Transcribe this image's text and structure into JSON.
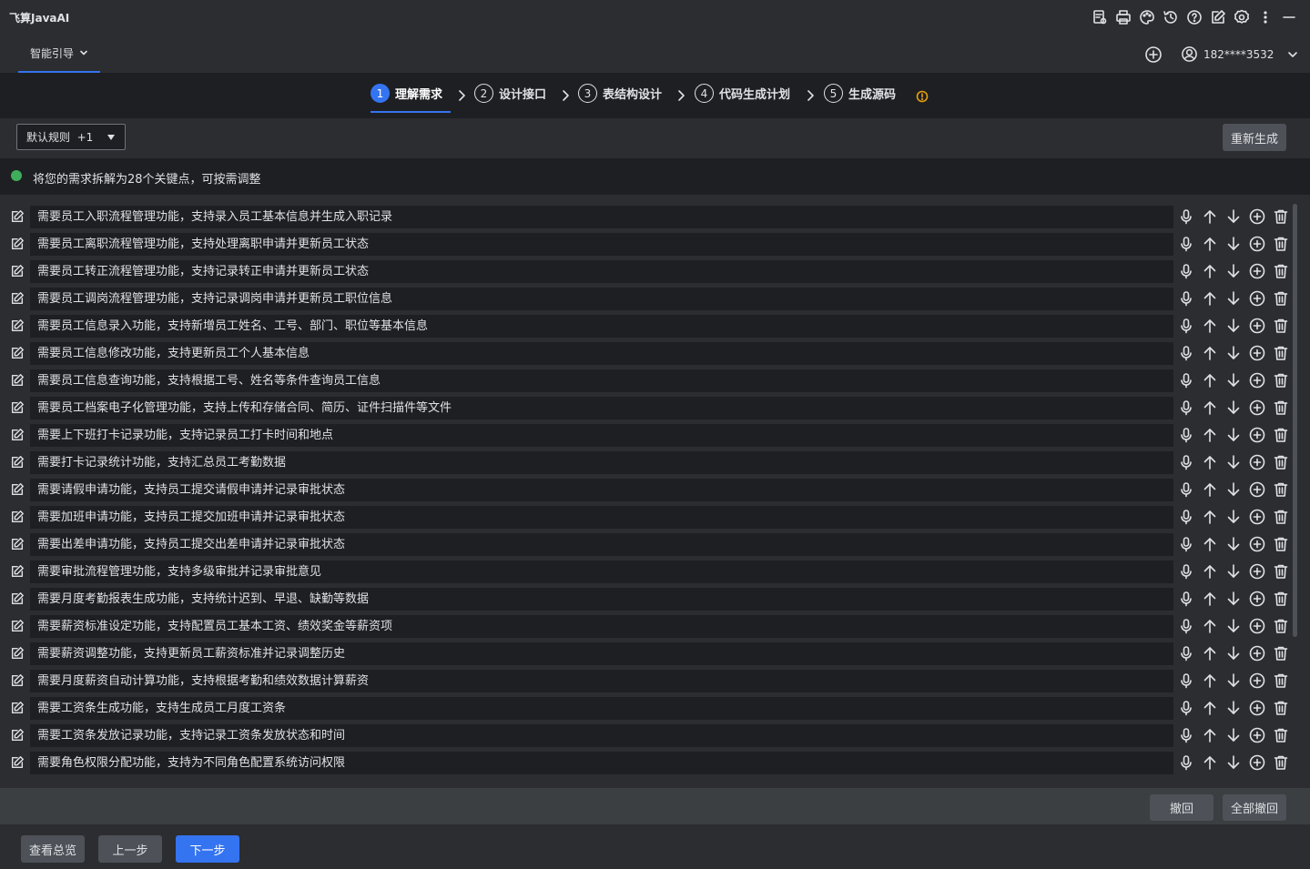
{
  "app": {
    "title": "飞算JavaAI"
  },
  "title_icons": [
    "document-settings-icon",
    "print-icon",
    "palette-icon",
    "history-icon",
    "help-icon",
    "edit-icon",
    "gear-icon",
    "more-vertical-icon",
    "minimize-icon"
  ],
  "nav": {
    "tab_label": "智能引导",
    "user_label": "182****3532"
  },
  "steps": [
    {
      "num": "1",
      "label": "理解需求",
      "active": true
    },
    {
      "num": "2",
      "label": "设计接口",
      "active": false
    },
    {
      "num": "3",
      "label": "表结构设计",
      "active": false
    },
    {
      "num": "4",
      "label": "代码生成计划",
      "active": false
    },
    {
      "num": "5",
      "label": "生成源码",
      "active": false
    }
  ],
  "rules": {
    "select_value": "默认规则  +1",
    "regenerate_label": "重新生成"
  },
  "summary": {
    "text": "将您的需求拆解为28个关键点，可按需调整"
  },
  "requirements": [
    "需要员工入职流程管理功能，支持录入员工基本信息并生成入职记录",
    "需要员工离职流程管理功能，支持处理离职申请并更新员工状态",
    "需要员工转正流程管理功能，支持记录转正申请并更新员工状态",
    "需要员工调岗流程管理功能，支持记录调岗申请并更新员工职位信息",
    "需要员工信息录入功能，支持新增员工姓名、工号、部门、职位等基本信息",
    "需要员工信息修改功能，支持更新员工个人基本信息",
    "需要员工信息查询功能，支持根据工号、姓名等条件查询员工信息",
    "需要员工档案电子化管理功能，支持上传和存储合同、简历、证件扫描件等文件",
    "需要上下班打卡记录功能，支持记录员工打卡时间和地点",
    "需要打卡记录统计功能，支持汇总员工考勤数据",
    "需要请假申请功能，支持员工提交请假申请并记录审批状态",
    "需要加班申请功能，支持员工提交加班申请并记录审批状态",
    "需要出差申请功能，支持员工提交出差申请并记录审批状态",
    "需要审批流程管理功能，支持多级审批并记录审批意见",
    "需要月度考勤报表生成功能，支持统计迟到、早退、缺勤等数据",
    "需要薪资标准设定功能，支持配置员工基本工资、绩效奖金等薪资项",
    "需要薪资调整功能，支持更新员工薪资标准并记录调整历史",
    "需要月度薪资自动计算功能，支持根据考勤和绩效数据计算薪资",
    "需要工资条生成功能，支持生成员工月度工资条",
    "需要工资条发放记录功能，支持记录工资条发放状态和时间",
    "需要角色权限分配功能，支持为不同角色配置系统访问权限"
  ],
  "undo": {
    "undo_label": "撤回",
    "undo_all_label": "全部撤回"
  },
  "footer": {
    "overview_label": "查看总览",
    "prev_label": "上一步",
    "next_label": "下一步"
  },
  "colors": {
    "accent": "#3574f0",
    "success": "#3fae5b",
    "warning": "#e5a00d"
  }
}
